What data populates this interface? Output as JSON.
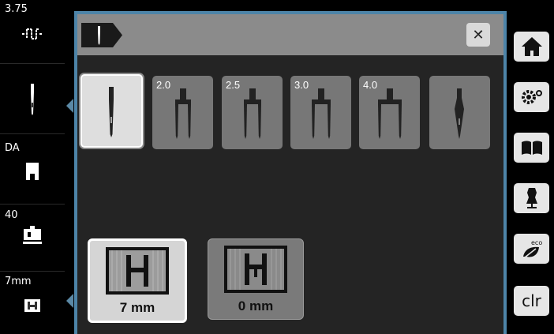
{
  "status": {
    "stitch_length": "3.75",
    "presser_foot_label": "DA",
    "presser_pressure": "40",
    "stitch_width": "7mm"
  },
  "needles": [
    {
      "label": "",
      "type": "single",
      "selected": true
    },
    {
      "label": "2.0",
      "type": "twin",
      "selected": false
    },
    {
      "label": "2.5",
      "type": "twin",
      "selected": false
    },
    {
      "label": "3.0",
      "type": "twin",
      "selected": false
    },
    {
      "label": "4.0",
      "type": "twin",
      "selected": false
    },
    {
      "label": "",
      "type": "wing",
      "selected": false
    }
  ],
  "stitch_plates": [
    {
      "label": "7 mm",
      "selected": true
    },
    {
      "label": "0 mm",
      "selected": false
    }
  ],
  "right_buttons": {
    "clr_label": "clr"
  },
  "colors": {
    "frame": "#4d84a8",
    "panel": "#242424",
    "header": "#8b8b8b"
  }
}
